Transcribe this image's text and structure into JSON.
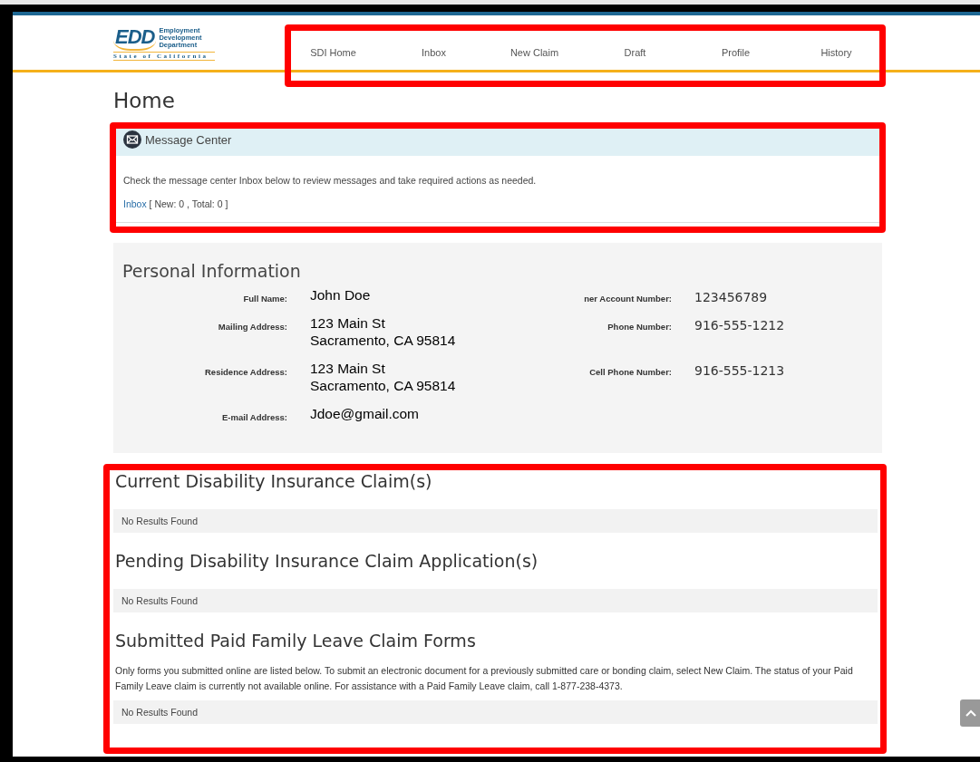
{
  "logo": {
    "mark": "EDD",
    "lines": [
      "Employment",
      "Development",
      "Department"
    ],
    "state": "State of California"
  },
  "nav": [
    {
      "label": "SDI Home"
    },
    {
      "label": "Inbox"
    },
    {
      "label": "New Claim"
    },
    {
      "label": "Draft"
    },
    {
      "label": "Profile"
    },
    {
      "label": "History"
    }
  ],
  "page_title": "Home",
  "message_center": {
    "title": "Message Center",
    "text": "Check the message center Inbox below to review messages and take required actions as needed.",
    "inbox_link": "Inbox",
    "counts": "[ New: 0 , Total: 0 ]"
  },
  "personal_info": {
    "title": "Personal Information",
    "left_fields": [
      {
        "label": "Full Name:",
        "value": [
          "John Doe"
        ]
      },
      {
        "label": "Mailing Address:",
        "value": [
          "123 Main St",
          "Sacramento, CA 95814"
        ]
      },
      {
        "label": "Residence Address:",
        "value": [
          "123 Main St",
          "Sacramento, CA 95814"
        ]
      },
      {
        "label": "E-mail Address:",
        "value": [
          "Jdoe@gmail.com"
        ]
      }
    ],
    "right_fields": [
      {
        "label": "ner Account Number:",
        "value": "123456789"
      },
      {
        "label": "Phone Number:",
        "value": "916-555-1212"
      },
      {
        "label": "Cell Phone Number:",
        "value": "916-555-1213"
      }
    ]
  },
  "sections": [
    {
      "title": "Current Disability Insurance Claim(s)",
      "empty_text": "No Results Found"
    },
    {
      "title": "Pending Disability Insurance Claim Application(s)",
      "empty_text": "No Results Found"
    },
    {
      "title": "Submitted Paid Family Leave Claim Forms",
      "note": "Only forms you submitted online are listed below. To submit an electronic document for a previously submitted care or bonding claim, select New Claim. The status of your Paid Family Leave claim is currently not available online. For assistance with a Paid Family Leave claim, call 1-877-238-4373.",
      "empty_text": "No Results Found"
    }
  ]
}
